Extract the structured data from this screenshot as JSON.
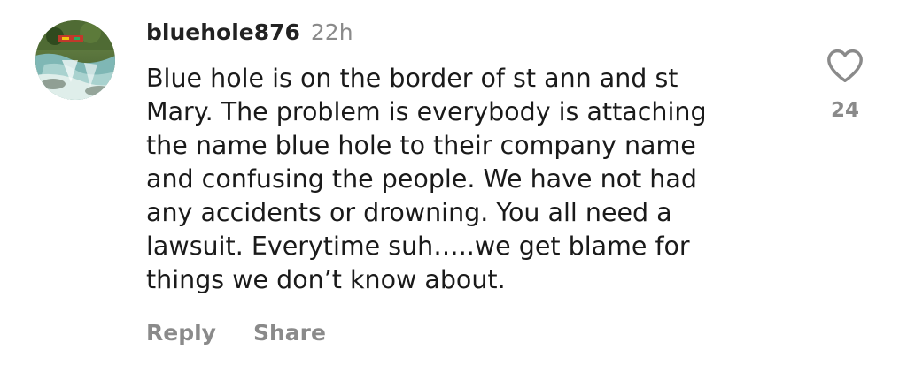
{
  "comment": {
    "username": "bluehole876",
    "time": "22h",
    "text_lines": [
      "Blue hole is on the border of st ann and st",
      "Mary. The problem is everybody is attaching",
      "the name blue hole to their company name",
      "and confusing the people. We have not had",
      "any accidents or drowning. You all need a",
      "lawsuit. Everytime suh…..we get blame for",
      "things we don’t know about."
    ],
    "like_count": "24",
    "like_icon": "heart-outline-icon",
    "avatar_icon": "waterfall-photo-avatar",
    "actions": {
      "reply_label": "Reply",
      "share_label": "Share"
    }
  },
  "colors": {
    "text": "#1a1a1a",
    "muted": "#8a8a8a",
    "background": "#ffffff"
  }
}
